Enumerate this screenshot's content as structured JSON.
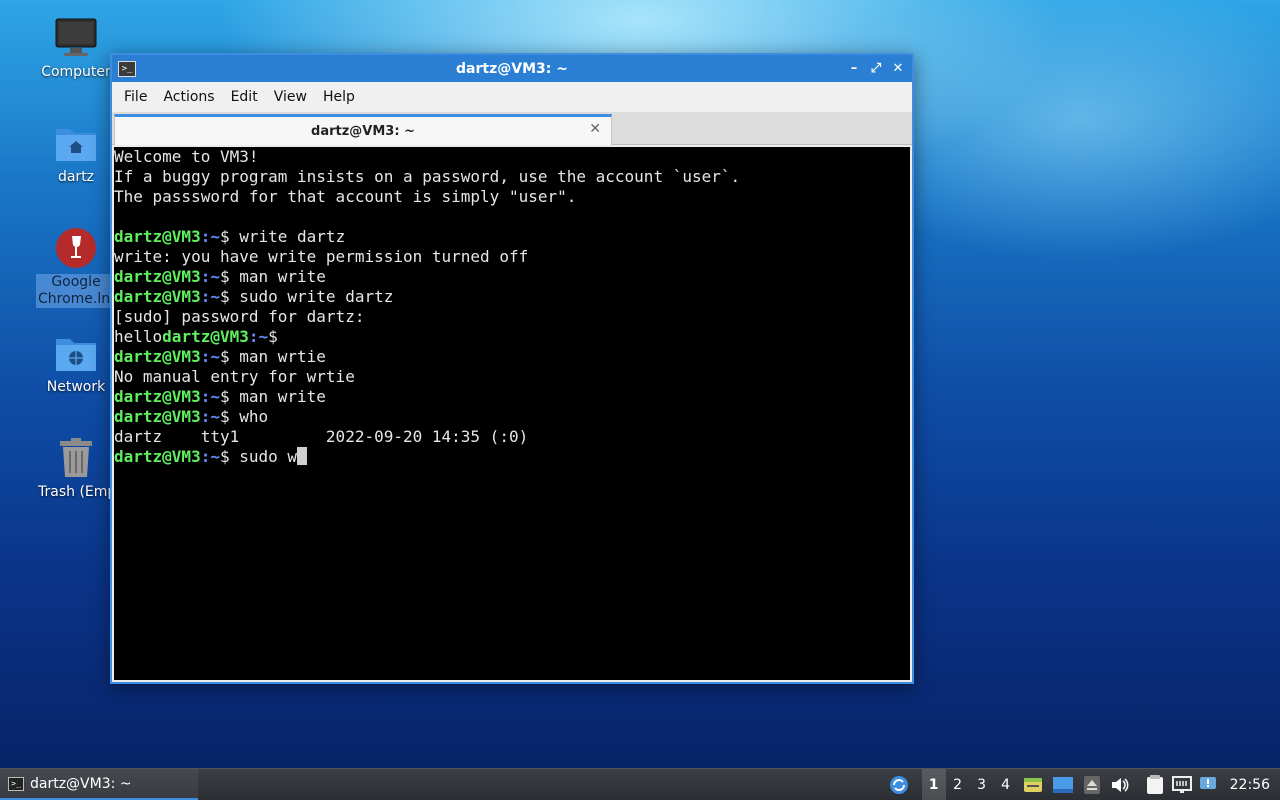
{
  "desktop": {
    "icons": [
      {
        "label": "Computer"
      },
      {
        "label": "dartz"
      },
      {
        "label": "Google Chrome.lnk"
      },
      {
        "label": "Network"
      },
      {
        "label": "Trash (Empty)"
      }
    ]
  },
  "window": {
    "title": "dartz@VM3: ~",
    "controls": {
      "minimize": "–",
      "maximize": "⤢",
      "close": "✕"
    },
    "menu": [
      "File",
      "Actions",
      "Edit",
      "View",
      "Help"
    ],
    "tab": {
      "label": "dartz@VM3: ~",
      "close": "✕"
    }
  },
  "terminal": {
    "prompt_user": "dartz@VM3",
    "prompt_path": ":~",
    "prompt_sym": "$ ",
    "lines": [
      {
        "kind": "out",
        "text": "Welcome to VM3!"
      },
      {
        "kind": "out",
        "text": "If a buggy program insists on a password, use the account `user`."
      },
      {
        "kind": "out",
        "text": "The passsword for that account is simply \"user\"."
      },
      {
        "kind": "out",
        "text": ""
      },
      {
        "kind": "cmd",
        "text": "write dartz"
      },
      {
        "kind": "out",
        "text": "write: you have write permission turned off"
      },
      {
        "kind": "cmd",
        "text": "man write"
      },
      {
        "kind": "cmd",
        "text": "sudo write dartz"
      },
      {
        "kind": "out",
        "text": "[sudo] password for dartz:"
      },
      {
        "kind": "cmd",
        "pre": "hello",
        "text": ""
      },
      {
        "kind": "cmd",
        "text": "man wrtie"
      },
      {
        "kind": "out",
        "text": "No manual entry for wrtie"
      },
      {
        "kind": "cmd",
        "text": "man write"
      },
      {
        "kind": "cmd",
        "text": "who"
      },
      {
        "kind": "out",
        "text": "dartz    tty1         2022-09-20 14:35 (:0)"
      },
      {
        "kind": "cmd",
        "text": "sudo w",
        "cursor": true
      }
    ]
  },
  "taskbar": {
    "task": "dartz@VM3: ~",
    "workspaces": [
      "1",
      "2",
      "3",
      "4"
    ],
    "active_workspace": 0,
    "clock": "22:56"
  },
  "colors": {
    "accent": "#2a7fd4",
    "prompt_user": "#5ff05f",
    "prompt_path": "#6b8cff"
  }
}
